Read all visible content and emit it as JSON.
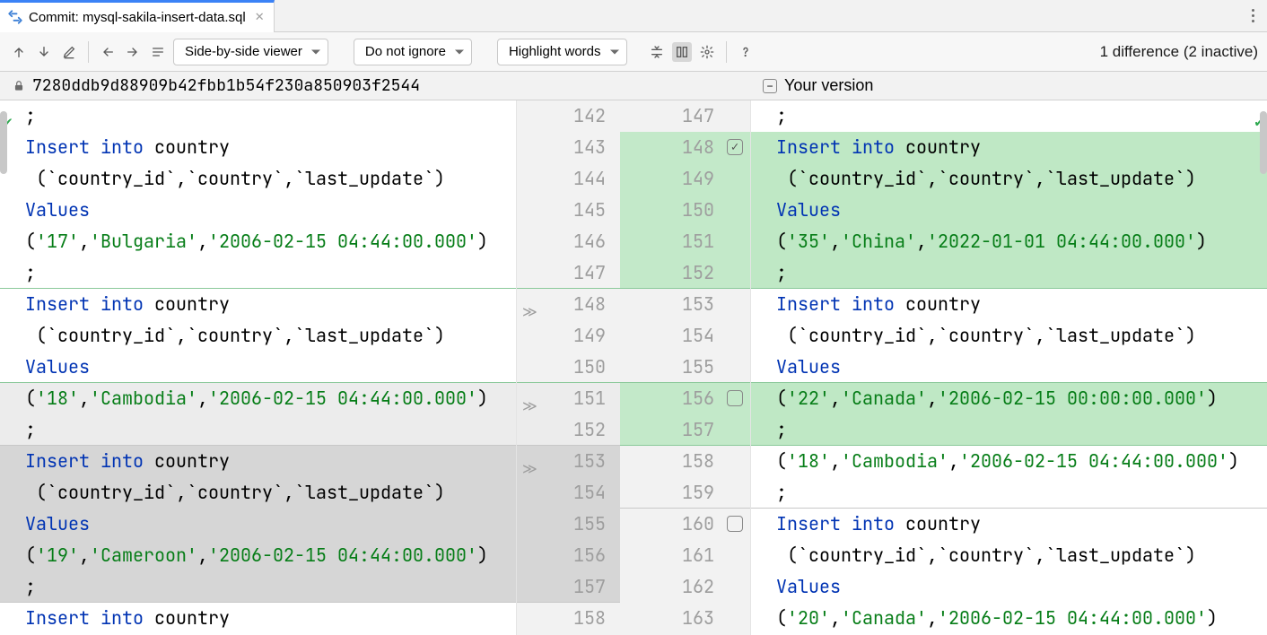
{
  "tab": {
    "title": "Commit: mysql-sakila-insert-data.sql"
  },
  "toolbar": {
    "viewer_mode": "Side-by-side viewer",
    "whitespace_mode": "Do not ignore",
    "highlight_mode": "Highlight words",
    "diff_summary": "1 difference (2 inactive)"
  },
  "headers": {
    "left": "7280ddb9d88909b42fbb1b54f230a850903f2544",
    "right": "Your version"
  },
  "left_lines": [
    {
      "n": 142,
      "bg": "",
      "tokens": [
        {
          "t": ";",
          "c": ""
        }
      ]
    },
    {
      "n": 143,
      "bg": "",
      "tokens": [
        {
          "t": "Insert into ",
          "c": "kw-blue"
        },
        {
          "t": "country",
          "c": ""
        }
      ]
    },
    {
      "n": 144,
      "bg": "",
      "tokens": [
        {
          "t": " (`country_id`,`country`,`last_update`)",
          "c": ""
        }
      ]
    },
    {
      "n": 145,
      "bg": "",
      "tokens": [
        {
          "t": "Values",
          "c": "kw-blue"
        }
      ]
    },
    {
      "n": 146,
      "bg": "",
      "tokens": [
        {
          "t": "(",
          "c": ""
        },
        {
          "t": "'17'",
          "c": "str-green"
        },
        {
          "t": ",",
          "c": ""
        },
        {
          "t": "'Bulgaria'",
          "c": "str-green"
        },
        {
          "t": ",",
          "c": ""
        },
        {
          "t": "'2006-02-15 04:44:00.000'",
          "c": "str-green"
        },
        {
          "t": ")",
          "c": ""
        }
      ]
    },
    {
      "n": 147,
      "bg": "",
      "sep": "green",
      "tokens": [
        {
          "t": ";",
          "c": ""
        }
      ]
    },
    {
      "n": 148,
      "bg": "",
      "chev": true,
      "tokens": [
        {
          "t": "Insert into ",
          "c": "kw-blue"
        },
        {
          "t": "country",
          "c": ""
        }
      ]
    },
    {
      "n": 149,
      "bg": "",
      "tokens": [
        {
          "t": " (`country_id`,`country`,`last_update`)",
          "c": ""
        }
      ]
    },
    {
      "n": 150,
      "bg": "",
      "sep": "green",
      "tokens": [
        {
          "t": "Values",
          "c": "kw-blue"
        }
      ]
    },
    {
      "n": 151,
      "bg": "bg-grey",
      "chev": true,
      "tokens": [
        {
          "t": "(",
          "c": ""
        },
        {
          "t": "'18'",
          "c": "str-green"
        },
        {
          "t": ",",
          "c": ""
        },
        {
          "t": "'Cambodia'",
          "c": "str-green"
        },
        {
          "t": ",",
          "c": ""
        },
        {
          "t": "'2006-02-15 04:44:00.000'",
          "c": "str-green"
        },
        {
          "t": ")",
          "c": ""
        }
      ]
    },
    {
      "n": 152,
      "bg": "bg-grey",
      "sep": "grey",
      "tokens": [
        {
          "t": ";",
          "c": ""
        }
      ]
    },
    {
      "n": 153,
      "bg": "bg-grey-dark",
      "chev": true,
      "tokens": [
        {
          "t": "Insert into ",
          "c": "kw-blue"
        },
        {
          "t": "country",
          "c": ""
        }
      ]
    },
    {
      "n": 154,
      "bg": "bg-grey-dark",
      "tokens": [
        {
          "t": " (`country_id`,`country`,`last_update`)",
          "c": ""
        }
      ]
    },
    {
      "n": 155,
      "bg": "bg-grey-dark",
      "tokens": [
        {
          "t": "Values",
          "c": "kw-blue"
        }
      ]
    },
    {
      "n": 156,
      "bg": "bg-grey-dark",
      "tokens": [
        {
          "t": "(",
          "c": ""
        },
        {
          "t": "'19'",
          "c": "str-green"
        },
        {
          "t": ",",
          "c": ""
        },
        {
          "t": "'Cameroon'",
          "c": "str-green"
        },
        {
          "t": ",",
          "c": ""
        },
        {
          "t": "'2006-02-15 04:44:00.000'",
          "c": "str-green"
        },
        {
          "t": ")",
          "c": ""
        }
      ]
    },
    {
      "n": 157,
      "bg": "bg-grey-dark",
      "sep": "grey",
      "tokens": [
        {
          "t": ";",
          "c": ""
        }
      ]
    },
    {
      "n": 158,
      "bg": "",
      "tokens": [
        {
          "t": "Insert into ",
          "c": "kw-blue"
        },
        {
          "t": "country",
          "c": ""
        }
      ]
    }
  ],
  "right_lines": [
    {
      "n": 147,
      "bg": "",
      "tokens": [
        {
          "t": ";",
          "c": ""
        }
      ]
    },
    {
      "n": 148,
      "bg": "bg-green",
      "cbox": "checked",
      "tokens": [
        {
          "t": "Insert into ",
          "c": "kw-blue"
        },
        {
          "t": "country",
          "c": ""
        }
      ]
    },
    {
      "n": 149,
      "bg": "bg-green",
      "tokens": [
        {
          "t": " (`country_id`,`country`,`last_update`)",
          "c": ""
        }
      ]
    },
    {
      "n": 150,
      "bg": "bg-green",
      "tokens": [
        {
          "t": "Values",
          "c": "kw-blue"
        }
      ]
    },
    {
      "n": 151,
      "bg": "bg-green",
      "tokens": [
        {
          "t": "(",
          "c": ""
        },
        {
          "t": "'35'",
          "c": "str-green"
        },
        {
          "t": ",",
          "c": ""
        },
        {
          "t": "'China'",
          "c": "str-green"
        },
        {
          "t": ",",
          "c": ""
        },
        {
          "t": "'2022-01-01 04:44:00.000'",
          "c": "str-green"
        },
        {
          "t": ")",
          "c": ""
        }
      ]
    },
    {
      "n": 152,
      "bg": "bg-green",
      "sep": "green",
      "tokens": [
        {
          "t": ";",
          "c": ""
        }
      ]
    },
    {
      "n": 153,
      "bg": "",
      "tokens": [
        {
          "t": "Insert into ",
          "c": "kw-blue"
        },
        {
          "t": "country",
          "c": ""
        }
      ]
    },
    {
      "n": 154,
      "bg": "",
      "tokens": [
        {
          "t": " (`country_id`,`country`,`last_update`)",
          "c": ""
        }
      ]
    },
    {
      "n": 155,
      "bg": "",
      "sep": "green",
      "tokens": [
        {
          "t": "Values",
          "c": "kw-blue"
        }
      ]
    },
    {
      "n": 156,
      "bg": "bg-green",
      "cbox": "empty",
      "tokens": [
        {
          "t": "(",
          "c": ""
        },
        {
          "t": "'22'",
          "c": "str-green"
        },
        {
          "t": ",",
          "c": ""
        },
        {
          "t": "'Canada'",
          "c": "str-green"
        },
        {
          "t": ",",
          "c": ""
        },
        {
          "t": "'2006-02-15 00:00:00.000'",
          "c": "str-green"
        },
        {
          "t": ")",
          "c": ""
        }
      ]
    },
    {
      "n": 157,
      "bg": "bg-green",
      "sep": "green",
      "tokens": [
        {
          "t": ";",
          "c": ""
        }
      ]
    },
    {
      "n": 158,
      "bg": "",
      "tokens": [
        {
          "t": "(",
          "c": ""
        },
        {
          "t": "'18'",
          "c": "str-green"
        },
        {
          "t": ",",
          "c": ""
        },
        {
          "t": "'Cambodia'",
          "c": "str-green"
        },
        {
          "t": ",",
          "c": ""
        },
        {
          "t": "'2006-02-15 04:44:00.000'",
          "c": "str-green"
        },
        {
          "t": ")",
          "c": ""
        }
      ]
    },
    {
      "n": 159,
      "bg": "",
      "sep": "grey",
      "tokens": [
        {
          "t": ";",
          "c": ""
        }
      ]
    },
    {
      "n": 160,
      "bg": "",
      "cbox": "empty",
      "tokens": [
        {
          "t": "Insert into ",
          "c": "kw-blue"
        },
        {
          "t": "country",
          "c": ""
        }
      ]
    },
    {
      "n": 161,
      "bg": "",
      "tokens": [
        {
          "t": " (`country_id`,`country`,`last_update`)",
          "c": ""
        }
      ]
    },
    {
      "n": 162,
      "bg": "",
      "tokens": [
        {
          "t": "Values",
          "c": "kw-blue"
        }
      ]
    },
    {
      "n": 163,
      "bg": "",
      "tokens": [
        {
          "t": "(",
          "c": ""
        },
        {
          "t": "'20'",
          "c": "str-green"
        },
        {
          "t": ",",
          "c": ""
        },
        {
          "t": "'Canada'",
          "c": "str-green"
        },
        {
          "t": ",",
          "c": ""
        },
        {
          "t": "'2006-02-15 04:44:00.000'",
          "c": "str-green"
        },
        {
          "t": ")",
          "c": ""
        }
      ]
    }
  ]
}
